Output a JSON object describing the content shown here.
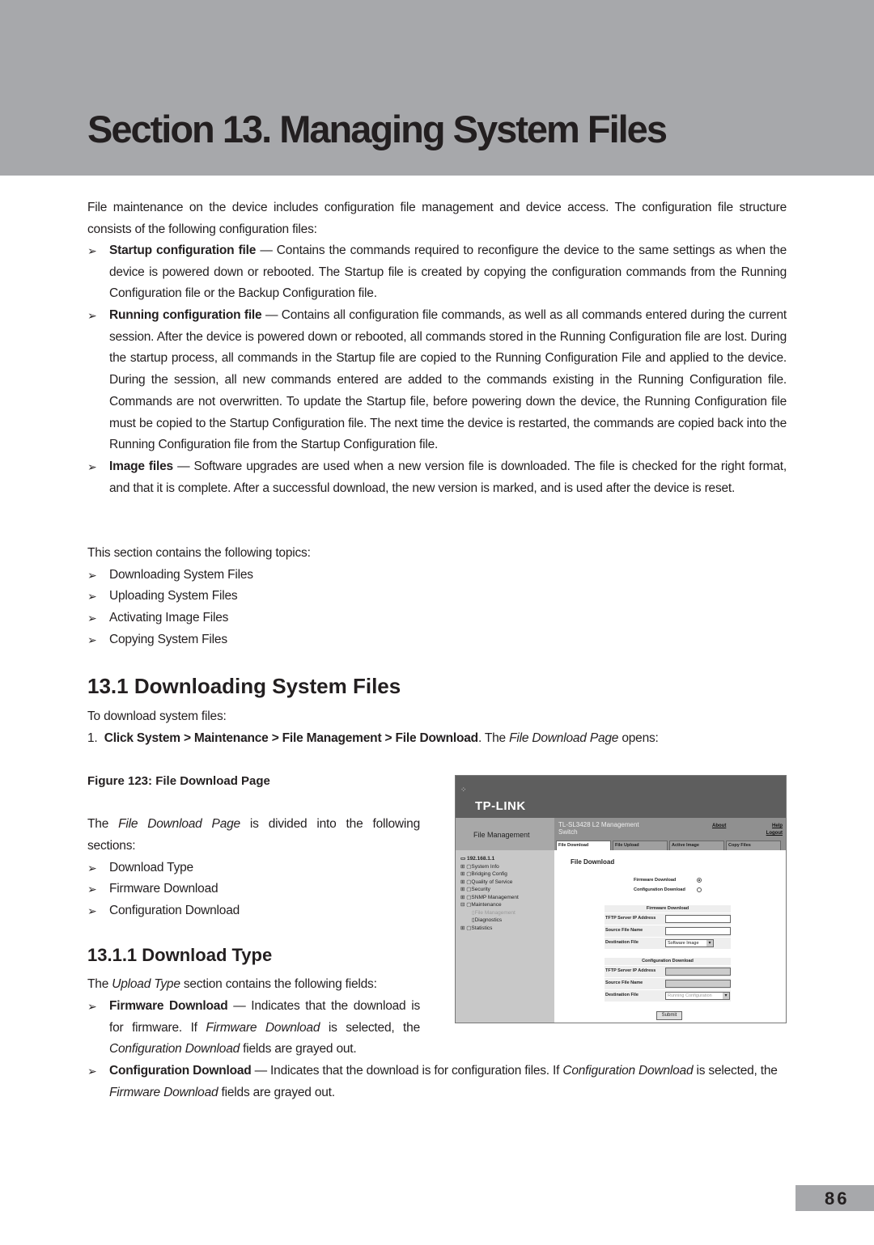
{
  "header": {
    "title": "Section 13.  Managing System Files"
  },
  "intro": {
    "paragraph": "File maintenance on the device includes configuration file management and device access. The configuration file structure consists of the following configuration files:",
    "bullets": [
      {
        "term": "Startup configuration file",
        "text": " — Contains the commands required to reconfigure the device to the same settings as when the device is powered down or rebooted. The Startup file is created by copying the configuration commands from the Running Configuration file or the Backup Configuration file."
      },
      {
        "term": "Running configuration file",
        "text": " — Contains all configuration file commands, as well as all commands entered during the current session. After the device is powered down or rebooted, all commands stored in the Running Configuration file are lost. During the startup process, all commands in the Startup file are copied to the Running Configuration File and applied to the device. During the session, all new commands entered are added to the commands existing in the Running Configuration file. Commands are not overwritten. To update the Startup file, before powering down the device, the Running Configuration file must be copied to the Startup Configuration file. The next time the device is restarted, the commands are copied back into the Running Configuration file from the Startup Configuration file."
      },
      {
        "term": "Image files",
        "text": " — Software upgrades are used when a new version file is downloaded. The file is checked for the right format, and that it is complete. After a successful download, the new version is marked, and is used after the device is reset."
      }
    ]
  },
  "topics": {
    "lead": "This section contains the following topics:",
    "items": [
      "Downloading System Files",
      "Uploading System Files",
      "Activating Image Files",
      "Copying System Files"
    ]
  },
  "section_13_1": {
    "heading": "13.1  Downloading System Files",
    "lead": "To download system files:",
    "step_num": "1.",
    "step_bold": "Click System > Maintenance > File Management > File Download",
    "step_mid": ". The ",
    "step_italic": "File Download Page",
    "step_end": " opens:",
    "figure_caption": "Figure 123: File Download Page",
    "divided_pre": "The ",
    "divided_italic": "File Download Page",
    "divided_post": " is divided into the following sections:",
    "sections": [
      "Download Type",
      "Firmware Download",
      "Configuration Download"
    ]
  },
  "section_13_1_1": {
    "heading": "13.1.1  Download Type",
    "lead_pre": "The ",
    "lead_italic": "Upload Type",
    "lead_post": " section contains the following fields:",
    "fw_term": "Firmware Download",
    "fw_text1": " — Indicates that the download is for firmware. If ",
    "fw_italic1": "Firmware Download",
    "fw_text2": " is selected, the ",
    "fw_italic2": "Configuration Download",
    "fw_text3": " fields are grayed out.",
    "cfg_term": "Configuration Download",
    "cfg_text1": " — Indicates that the download is for configuration files. If ",
    "cfg_italic1": "Configuration Download",
    "cfg_text2": " is selected, the ",
    "cfg_italic2": "Firmware Download",
    "cfg_text3": " fields are grayed out."
  },
  "screenshot": {
    "logo": "TP-LINK",
    "left_title": "File Management",
    "product": "TL-SL3428 L2 Management Switch",
    "about": "About",
    "help": "Help",
    "logout": "Logout",
    "tabs": [
      "File Download",
      "File Upload",
      "Active Image",
      "Copy Files"
    ],
    "tree": [
      "192.168.1.1",
      "System Info",
      "Bridging Config",
      "Quality of Service",
      "Security",
      "SNMP Management",
      "Maintenance",
      "File Management",
      "Diagnostics",
      "Statistics"
    ],
    "page_title": "File Download",
    "radio_firmware": "Firmware Download",
    "radio_config": "Configuration Download",
    "fw_table_title": "Firmware Download",
    "cfg_table_title": "Configuration Download",
    "tftp_label": "TFTP Server IP Address",
    "source_label": "Source File Name",
    "dest_label": "Destination File",
    "fw_dest_value": "Software Image",
    "cfg_dest_value": "Running Configuration",
    "submit": "Submit"
  },
  "page_number": "86"
}
